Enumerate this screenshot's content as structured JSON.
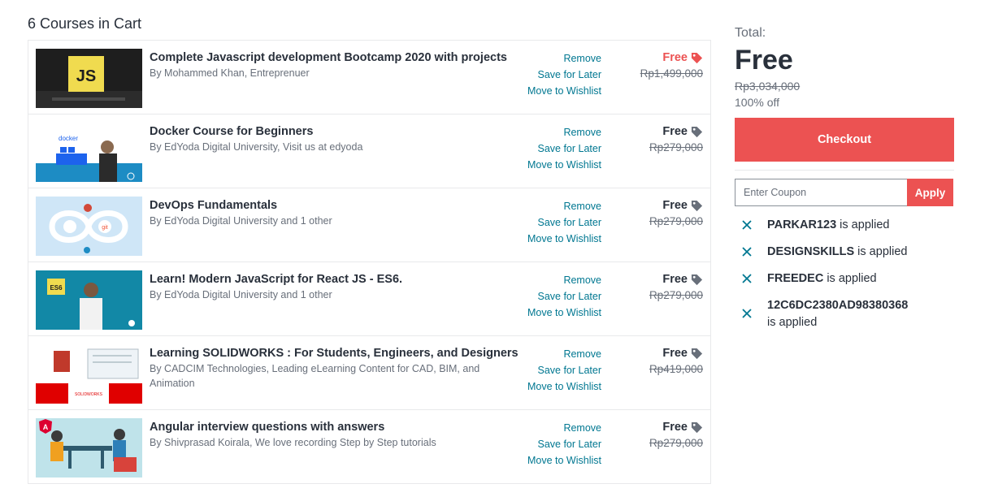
{
  "cart": {
    "heading": "6 Courses in Cart",
    "items": [
      {
        "title": "Complete Javascript development Bootcamp 2020 with projects",
        "author": "By Mohammed Khan, Entreprenuer",
        "remove_label": "Remove",
        "save_label": "Save for Later",
        "wishlist_label": "Move to Wishlist",
        "price": "Free",
        "original_price": "Rp1,499,000",
        "thumb_text": "JS"
      },
      {
        "title": "Docker Course for Beginners",
        "author": "By EdYoda Digital University, Visit us at edyoda",
        "remove_label": "Remove",
        "save_label": "Save for Later",
        "wishlist_label": "Move to Wishlist",
        "price": "Free",
        "original_price": "Rp279,000",
        "thumb_text": "docker"
      },
      {
        "title": "DevOps Fundamentals",
        "author": "By EdYoda Digital University and 1 other",
        "remove_label": "Remove",
        "save_label": "Save for Later",
        "wishlist_label": "Move to Wishlist",
        "price": "Free",
        "original_price": "Rp279,000",
        "thumb_text": "git"
      },
      {
        "title": "Learn! Modern JavaScript for React JS - ES6.",
        "author": "By EdYoda Digital University and 1 other",
        "remove_label": "Remove",
        "save_label": "Save for Later",
        "wishlist_label": "Move to Wishlist",
        "price": "Free",
        "original_price": "Rp279,000",
        "thumb_text": "ES6"
      },
      {
        "title": "Learning SOLIDWORKS : For Students, Engineers, and Designers",
        "author": "By CADCIM Technologies, Leading eLearning Content for CAD, BIM, and Animation",
        "remove_label": "Remove",
        "save_label": "Save for Later",
        "wishlist_label": "Move to Wishlist",
        "price": "Free",
        "original_price": "Rp419,000",
        "thumb_text": "SOLIDWORKS"
      },
      {
        "title": "Angular interview questions with answers",
        "author": "By Shivprasad Koirala, We love recording Step by Step tutorials",
        "remove_label": "Remove",
        "save_label": "Save for Later",
        "wishlist_label": "Move to Wishlist",
        "price": "Free",
        "original_price": "Rp279,000",
        "thumb_text": "A"
      }
    ]
  },
  "summary": {
    "total_label": "Total:",
    "total_value": "Free",
    "original_total": "Rp3,034,000",
    "discount": "100% off",
    "checkout_label": "Checkout"
  },
  "coupon": {
    "placeholder": "Enter Coupon",
    "value": "",
    "apply_label": "Apply",
    "applied": [
      {
        "code": "PARKAR123",
        "suffix": " is applied"
      },
      {
        "code": "DESIGNSKILLS",
        "suffix": " is applied"
      },
      {
        "code": "FREEDEC",
        "suffix": " is applied"
      },
      {
        "code": "12C6DC2380AD98380368",
        "suffix": " is applied"
      }
    ]
  },
  "colors": {
    "accent": "#ec5252",
    "link": "#007791",
    "text": "#29303b",
    "muted": "#686f7a",
    "tag_gray": "#686f7a",
    "coupon_x": "#007791"
  },
  "icons": {
    "price_tag": "tag-icon",
    "remove_coupon": "close-icon"
  }
}
